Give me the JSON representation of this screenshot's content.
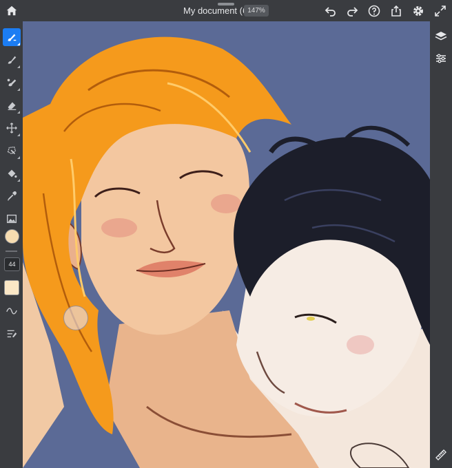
{
  "header": {
    "title": "My document (6)",
    "zoom": "147%"
  },
  "toolbar": {
    "brush_size": "44",
    "primary_color": "#f6dcb0",
    "secondary_color": "#fbe7c6",
    "active_tool": "brush"
  },
  "icons": {
    "home": "home-icon",
    "undo": "undo-icon",
    "redo": "redo-icon",
    "help": "help-icon",
    "share": "share-icon",
    "settings": "gear-icon",
    "fullscreen": "fullscreen-icon",
    "layers": "layers-icon",
    "adjust": "sliders-icon",
    "ruler": "ruler-icon"
  },
  "colors": {
    "accent": "#1c7df3",
    "canvas_bg": "#5b6a96"
  }
}
